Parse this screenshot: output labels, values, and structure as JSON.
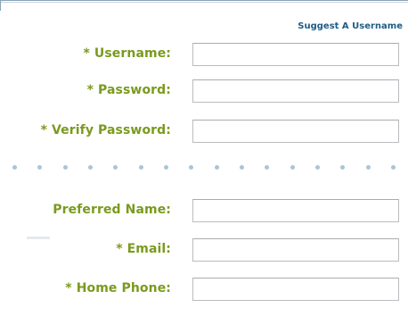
{
  "header": {
    "suggest_username_link": "Suggest A Username"
  },
  "form": {
    "fields": [
      {
        "label": "* Username:",
        "value": ""
      },
      {
        "label": "* Password:",
        "value": ""
      },
      {
        "label": "* Verify Password:",
        "value": ""
      },
      {
        "label": "Preferred Name:",
        "value": ""
      },
      {
        "label": "* Email:",
        "value": ""
      },
      {
        "label": "* Home Phone:",
        "value": ""
      }
    ]
  },
  "colors": {
    "label_green": "#7a9a1e",
    "link_blue": "#1f5d86",
    "divider_dot": "#a9c6d6",
    "field_border": "#b9bcbf"
  }
}
